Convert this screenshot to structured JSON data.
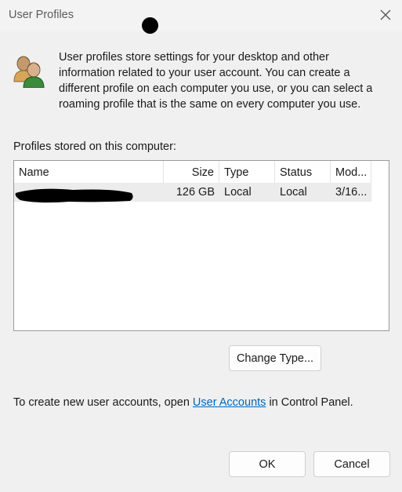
{
  "window": {
    "title": "User Profiles"
  },
  "intro": {
    "text": "User profiles store settings for your desktop and other information related to your user account. You can create a different profile on each computer you use, or you can select a roaming profile that is the same on every computer you use."
  },
  "profiles": {
    "label": "Profiles stored on this computer:",
    "columns": [
      "Name",
      "Size",
      "Type",
      "Status",
      "Mod..."
    ],
    "rows": [
      {
        "name": "",
        "size": "126 GB",
        "type": "Local",
        "status": "Local",
        "modified": "3/16..."
      }
    ]
  },
  "buttons": {
    "change_type": "Change Type...",
    "ok": "OK",
    "cancel": "Cancel"
  },
  "footer": {
    "prefix": "To create new user accounts, open ",
    "link": "User Accounts",
    "suffix": " in Control Panel."
  },
  "colors": {
    "link": "#0066b8",
    "selected_row": "#ececec"
  }
}
